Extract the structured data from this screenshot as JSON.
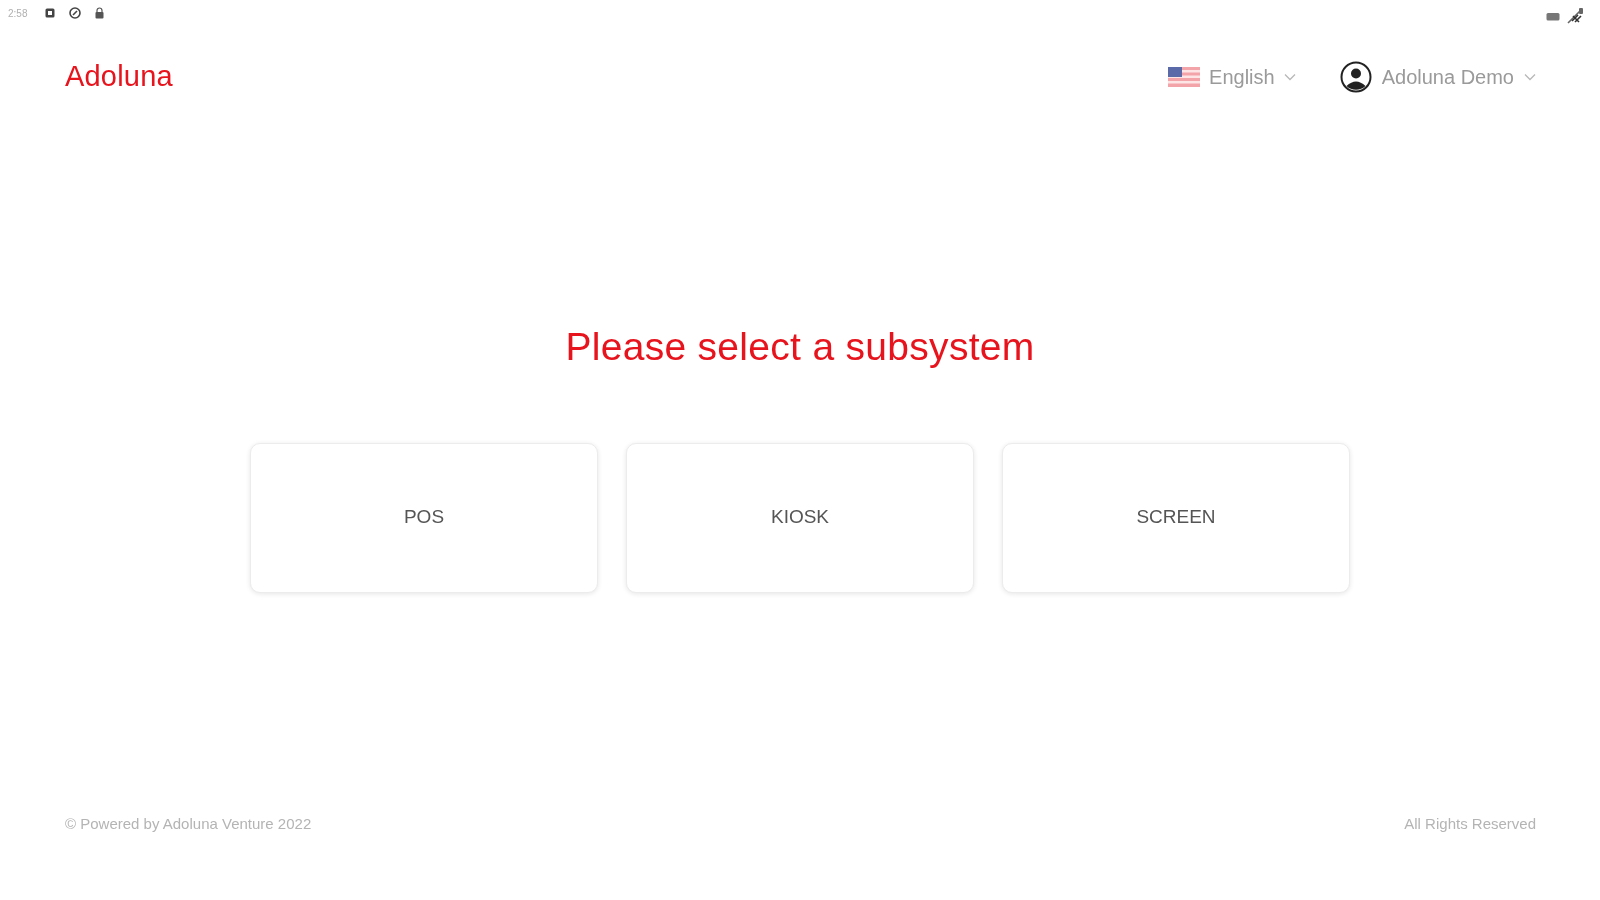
{
  "status_bar": {
    "time": "2:58"
  },
  "header": {
    "logo": "Adoluna",
    "language": {
      "label": "English"
    },
    "user": {
      "name": "Adoluna Demo"
    }
  },
  "main": {
    "title": "Please select a subsystem",
    "subsystems": [
      {
        "label": "POS"
      },
      {
        "label": "KIOSK"
      },
      {
        "label": "SCREEN"
      }
    ]
  },
  "footer": {
    "left": "© Powered by Adoluna Venture 2022",
    "right": "All Rights Reserved"
  }
}
